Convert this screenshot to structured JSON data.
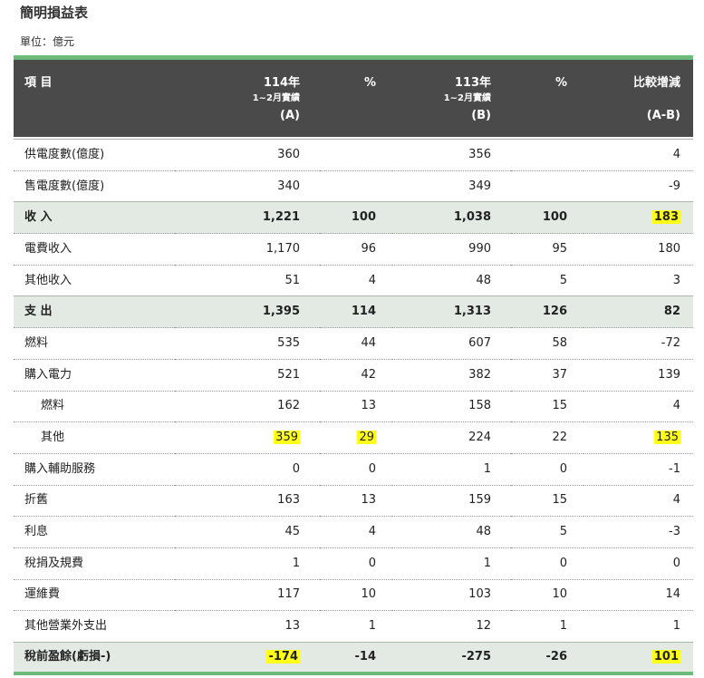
{
  "title": "簡明損益表",
  "unit": "單位：億元",
  "header": {
    "item": "項 目",
    "a": {
      "year": "114年",
      "sub": "1~2月實績",
      "code": "(A)"
    },
    "pa": "%",
    "b": {
      "year": "113年",
      "sub": "1~2月實績",
      "code": "(B)"
    },
    "pb": "%",
    "diff": {
      "label": "比較增減",
      "code": "(A-B)"
    }
  },
  "highlight_color": "#ffff1a",
  "rows": [
    {
      "label": "供電度數(億度)",
      "a": "360",
      "pa": "",
      "b": "356",
      "pb": "",
      "diff": "4"
    },
    {
      "label": "售電度數(億度)",
      "a": "340",
      "pa": "",
      "b": "349",
      "pb": "",
      "diff": "-9"
    },
    {
      "label": "收 入",
      "a": "1,221",
      "pa": "100",
      "b": "1,038",
      "pb": "100",
      "diff": "183"
    },
    {
      "label": "電費收入",
      "a": "1,170",
      "pa": "96",
      "b": "990",
      "pb": "95",
      "diff": "180"
    },
    {
      "label": "其他收入",
      "a": "51",
      "pa": "4",
      "b": "48",
      "pb": "5",
      "diff": "3"
    },
    {
      "label": "支 出",
      "a": "1,395",
      "pa": "114",
      "b": "1,313",
      "pb": "126",
      "diff": "82"
    },
    {
      "label": "燃料",
      "a": "535",
      "pa": "44",
      "b": "607",
      "pb": "58",
      "diff": "-72"
    },
    {
      "label": "購入電力",
      "a": "521",
      "pa": "42",
      "b": "382",
      "pb": "37",
      "diff": "139"
    },
    {
      "label": "燃料",
      "a": "162",
      "pa": "13",
      "b": "158",
      "pb": "15",
      "diff": "4"
    },
    {
      "label": "其他",
      "a": "359",
      "pa": "29",
      "b": "224",
      "pb": "22",
      "diff": "135"
    },
    {
      "label": "購入輔助服務",
      "a": "0",
      "pa": "0",
      "b": "1",
      "pb": "0",
      "diff": "-1"
    },
    {
      "label": "折舊",
      "a": "163",
      "pa": "13",
      "b": "159",
      "pb": "15",
      "diff": "4"
    },
    {
      "label": "利息",
      "a": "45",
      "pa": "4",
      "b": "48",
      "pb": "5",
      "diff": "-3"
    },
    {
      "label": "稅捐及規費",
      "a": "1",
      "pa": "0",
      "b": "1",
      "pb": "0",
      "diff": "0"
    },
    {
      "label": "運維費",
      "a": "117",
      "pa": "10",
      "b": "103",
      "pb": "10",
      "diff": "14"
    },
    {
      "label": "其他營業外支出",
      "a": "13",
      "pa": "1",
      "b": "12",
      "pb": "1",
      "diff": "1"
    },
    {
      "label": "稅前盈餘(虧損-)",
      "a": "-174",
      "pa": "-14",
      "b": "-275",
      "pb": "-26",
      "diff": "101"
    }
  ]
}
